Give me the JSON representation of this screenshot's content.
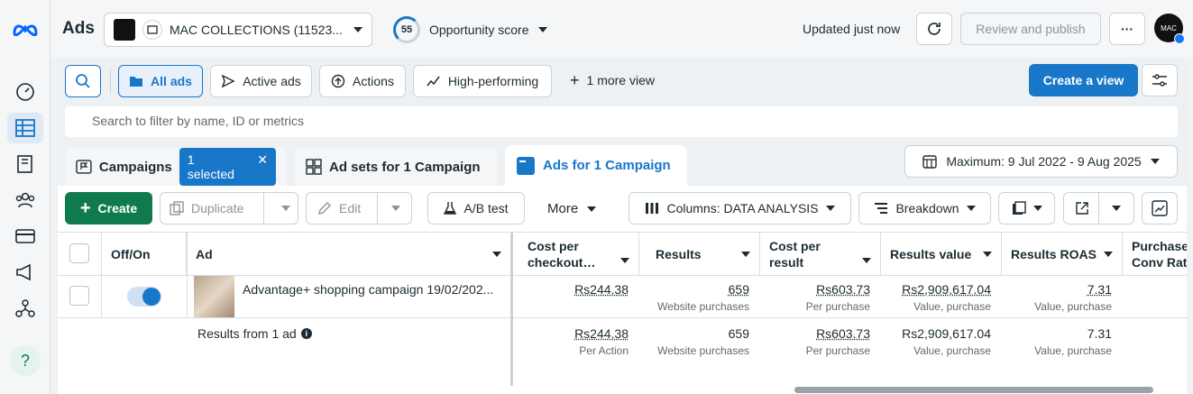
{
  "topbar": {
    "title": "Ads",
    "account_name": "MAC COLLECTIONS (11523...",
    "score_value": "55",
    "score_label": "Opportunity score",
    "updated_text": "Updated just now",
    "review_label": "Review and publish",
    "avatar_text": "MAC"
  },
  "views": {
    "all_ads": "All ads",
    "active_ads": "Active ads",
    "actions": "Actions",
    "high_performing": "High-performing",
    "more_view": "1 more view",
    "create_view": "Create a view"
  },
  "search": {
    "placeholder": "Search to filter by name, ID or metrics"
  },
  "tabs": {
    "campaigns": "Campaigns",
    "selected_badge": "1 selected",
    "adsets": "Ad sets for 1 Campaign",
    "ads": "Ads for 1 Campaign"
  },
  "date_range": "Maximum: 9 Jul 2022 - 9 Aug 2025",
  "toolbar": {
    "create": "Create",
    "duplicate": "Duplicate",
    "edit": "Edit",
    "ab_test": "A/B test",
    "more": "More",
    "columns": "Columns: DATA ANALYSIS",
    "breakdown": "Breakdown"
  },
  "table": {
    "headers": {
      "offon": "Off/On",
      "ad": "Ad",
      "cost_checkout": "Cost per checkout…",
      "results": "Results",
      "cost_result": "Cost per result",
      "results_value": "Results value",
      "roas": "Results ROAS",
      "purchase_conv": "Purchase Conv Rat"
    },
    "row": {
      "ad_name": "Advantage+ shopping campaign 19/02/202...",
      "cost_checkout": "Rs244.38",
      "results": "659",
      "results_sub": "Website purchases",
      "cost_result": "Rs603.73",
      "cost_result_sub": "Per purchase",
      "results_value": "Rs2,909,617.04",
      "results_value_sub": "Value, purchase",
      "roas": "7.31",
      "roas_sub": "Value, purchase",
      "toggle_on": true
    },
    "summary": {
      "label": "Results from 1 ad",
      "cost_checkout": "Rs244.38",
      "cost_checkout_sub": "Per Action",
      "results": "659",
      "results_sub": "Website purchases",
      "cost_result": "Rs603.73",
      "cost_result_sub": "Per purchase",
      "results_value": "Rs2,909,617.04",
      "results_value_sub": "Value, purchase",
      "roas": "7.31",
      "roas_sub": "Value, purchase"
    }
  },
  "colors": {
    "accent": "#1877c9",
    "create_green": "#0f7b4d"
  },
  "icons": [
    "meta-logo-icon",
    "dashboard-icon",
    "table-icon",
    "catalog-icon",
    "audience-icon",
    "billing-icon",
    "megaphone-icon",
    "network-icon",
    "help-icon",
    "refresh-icon",
    "more-icon",
    "search-icon",
    "folder-icon",
    "send-icon",
    "actions-icon",
    "trend-icon",
    "plus-icon",
    "settings-sliders-icon",
    "flag-icon",
    "adsets-icon",
    "ads-icon",
    "calendar-icon",
    "duplicate-icon",
    "pencil-icon",
    "flask-icon",
    "columns-icon",
    "breakdown-icon",
    "report-icon",
    "export-icon",
    "chart-icon",
    "info-icon"
  ]
}
